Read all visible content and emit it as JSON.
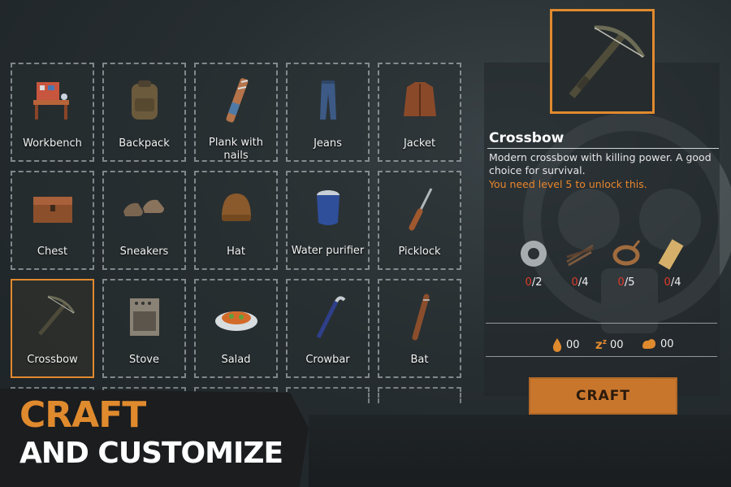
{
  "grid": {
    "items": [
      {
        "label": "Workbench",
        "icon": "workbench-icon"
      },
      {
        "label": "Backpack",
        "icon": "backpack-icon"
      },
      {
        "label": "Plank with nails",
        "icon": "plank-with-nails-icon"
      },
      {
        "label": "Jeans",
        "icon": "jeans-icon"
      },
      {
        "label": "Jacket",
        "icon": "jacket-icon"
      },
      {
        "label": "Chest",
        "icon": "chest-icon"
      },
      {
        "label": "Sneakers",
        "icon": "sneakers-icon"
      },
      {
        "label": "Hat",
        "icon": "hat-icon"
      },
      {
        "label": "Water purifier",
        "icon": "water-purifier-icon"
      },
      {
        "label": "Picklock",
        "icon": "picklock-icon"
      },
      {
        "label": "Crossbow",
        "icon": "crossbow-icon",
        "selected": true
      },
      {
        "label": "Stove",
        "icon": "stove-icon"
      },
      {
        "label": "Salad",
        "icon": "salad-icon"
      },
      {
        "label": "Crowbar",
        "icon": "crowbar-icon"
      },
      {
        "label": "Bat",
        "icon": "bat-icon"
      }
    ]
  },
  "detail": {
    "title": "Crossbow",
    "description": "Modern crossbow with killing power. A good choice for survival.",
    "requirement": "You need level 5 to unlock this.",
    "resources": [
      {
        "icon": "duct-tape-icon",
        "have": "0",
        "need": "/2"
      },
      {
        "icon": "sticks-icon",
        "have": "0",
        "need": "/4"
      },
      {
        "icon": "rope-icon",
        "have": "0",
        "need": "/5"
      },
      {
        "icon": "plank-icon",
        "have": "0",
        "need": "/4"
      }
    ],
    "stats": [
      {
        "icon": "water-drop-icon",
        "value": "00"
      },
      {
        "icon": "sleep-icon",
        "value": "00"
      },
      {
        "icon": "stomach-icon",
        "value": "00"
      }
    ],
    "craft_label": "CRAFT"
  },
  "slogan": {
    "line1": "CRAFT",
    "line2": "AND CUSTOMIZE"
  },
  "colors": {
    "accent": "#e08a2e",
    "warning": "#e8862c",
    "missing": "#e03a2a",
    "button": "#c9762d"
  }
}
